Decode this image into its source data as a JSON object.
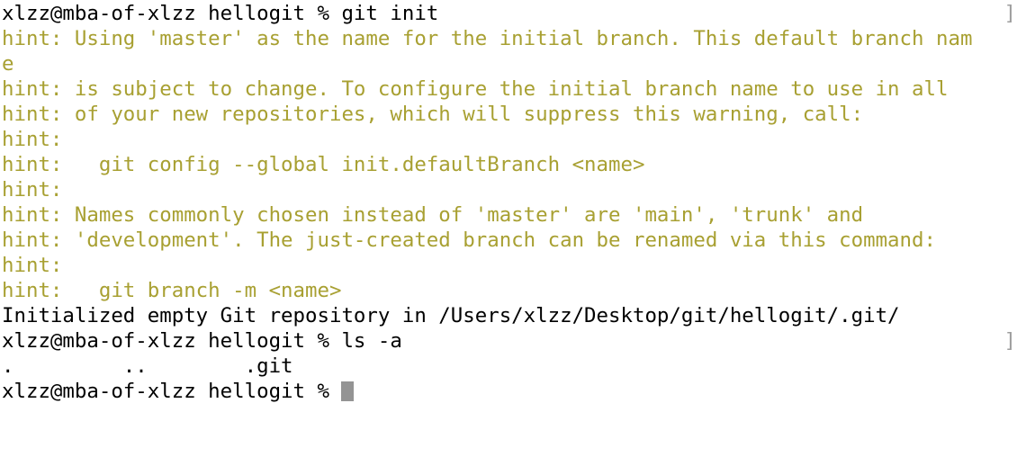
{
  "terminal": {
    "colors": {
      "background": "#ffffff",
      "foreground": "#000000",
      "hint": "#a8a032",
      "cursor": "#949494",
      "edge_marker": "#9e9e9e"
    },
    "prompt": "xlzz@mba-of-xlzz hellogit % ",
    "edge_marker_glyph": "]",
    "lines": [
      {
        "text": "xlzz@mba-of-xlzz hellogit % git init",
        "color": "default",
        "edge_marker": true
      },
      {
        "text": "hint: Using 'master' as the name for the initial branch. This default branch nam",
        "color": "hint",
        "edge_marker": false
      },
      {
        "text": "e",
        "color": "hint",
        "edge_marker": false
      },
      {
        "text": "hint: is subject to change. To configure the initial branch name to use in all",
        "color": "hint",
        "edge_marker": false
      },
      {
        "text": "hint: of your new repositories, which will suppress this warning, call:",
        "color": "hint",
        "edge_marker": false
      },
      {
        "text": "hint:",
        "color": "hint",
        "edge_marker": false
      },
      {
        "text": "hint:   git config --global init.defaultBranch <name>",
        "color": "hint",
        "edge_marker": false
      },
      {
        "text": "hint:",
        "color": "hint",
        "edge_marker": false
      },
      {
        "text": "hint: Names commonly chosen instead of 'master' are 'main', 'trunk' and",
        "color": "hint",
        "edge_marker": false
      },
      {
        "text": "hint: 'development'. The just-created branch can be renamed via this command:",
        "color": "hint",
        "edge_marker": false
      },
      {
        "text": "hint:",
        "color": "hint",
        "edge_marker": false
      },
      {
        "text": "hint:   git branch -m <name>",
        "color": "hint",
        "edge_marker": false
      },
      {
        "text": "Initialized empty Git repository in /Users/xlzz/Desktop/git/hellogit/.git/",
        "color": "default",
        "edge_marker": false
      },
      {
        "text": "xlzz@mba-of-xlzz hellogit % ls -a",
        "color": "default",
        "edge_marker": true
      },
      {
        "text": ".         ..        .git",
        "color": "default",
        "edge_marker": false
      },
      {
        "text": "xlzz@mba-of-xlzz hellogit % ",
        "color": "default",
        "edge_marker": false,
        "cursor": true
      }
    ]
  }
}
